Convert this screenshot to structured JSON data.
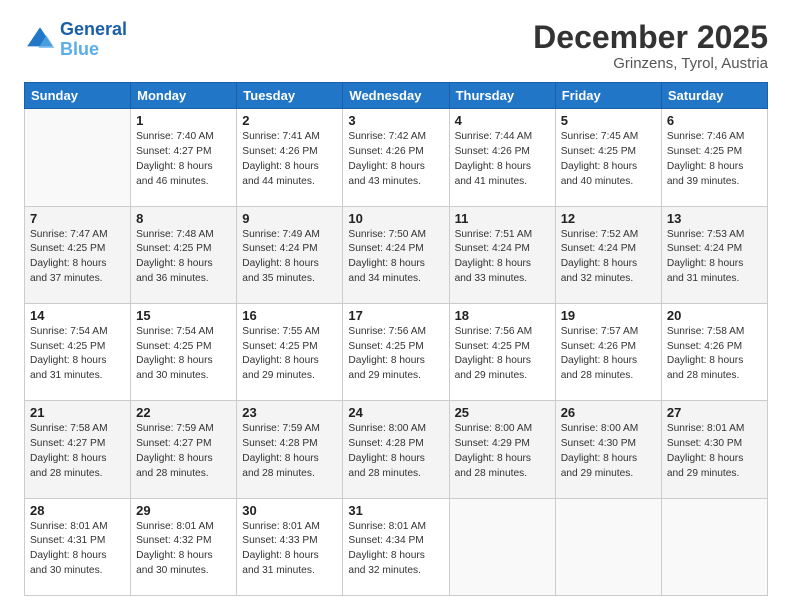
{
  "header": {
    "logo_line1": "General",
    "logo_line2": "Blue",
    "month": "December 2025",
    "location": "Grinzens, Tyrol, Austria"
  },
  "weekdays": [
    "Sunday",
    "Monday",
    "Tuesday",
    "Wednesday",
    "Thursday",
    "Friday",
    "Saturday"
  ],
  "weeks": [
    [
      {
        "day": "",
        "info": ""
      },
      {
        "day": "1",
        "info": "Sunrise: 7:40 AM\nSunset: 4:27 PM\nDaylight: 8 hours\nand 46 minutes."
      },
      {
        "day": "2",
        "info": "Sunrise: 7:41 AM\nSunset: 4:26 PM\nDaylight: 8 hours\nand 44 minutes."
      },
      {
        "day": "3",
        "info": "Sunrise: 7:42 AM\nSunset: 4:26 PM\nDaylight: 8 hours\nand 43 minutes."
      },
      {
        "day": "4",
        "info": "Sunrise: 7:44 AM\nSunset: 4:26 PM\nDaylight: 8 hours\nand 41 minutes."
      },
      {
        "day": "5",
        "info": "Sunrise: 7:45 AM\nSunset: 4:25 PM\nDaylight: 8 hours\nand 40 minutes."
      },
      {
        "day": "6",
        "info": "Sunrise: 7:46 AM\nSunset: 4:25 PM\nDaylight: 8 hours\nand 39 minutes."
      }
    ],
    [
      {
        "day": "7",
        "info": "Sunrise: 7:47 AM\nSunset: 4:25 PM\nDaylight: 8 hours\nand 37 minutes."
      },
      {
        "day": "8",
        "info": "Sunrise: 7:48 AM\nSunset: 4:25 PM\nDaylight: 8 hours\nand 36 minutes."
      },
      {
        "day": "9",
        "info": "Sunrise: 7:49 AM\nSunset: 4:24 PM\nDaylight: 8 hours\nand 35 minutes."
      },
      {
        "day": "10",
        "info": "Sunrise: 7:50 AM\nSunset: 4:24 PM\nDaylight: 8 hours\nand 34 minutes."
      },
      {
        "day": "11",
        "info": "Sunrise: 7:51 AM\nSunset: 4:24 PM\nDaylight: 8 hours\nand 33 minutes."
      },
      {
        "day": "12",
        "info": "Sunrise: 7:52 AM\nSunset: 4:24 PM\nDaylight: 8 hours\nand 32 minutes."
      },
      {
        "day": "13",
        "info": "Sunrise: 7:53 AM\nSunset: 4:24 PM\nDaylight: 8 hours\nand 31 minutes."
      }
    ],
    [
      {
        "day": "14",
        "info": "Sunrise: 7:54 AM\nSunset: 4:25 PM\nDaylight: 8 hours\nand 31 minutes."
      },
      {
        "day": "15",
        "info": "Sunrise: 7:54 AM\nSunset: 4:25 PM\nDaylight: 8 hours\nand 30 minutes."
      },
      {
        "day": "16",
        "info": "Sunrise: 7:55 AM\nSunset: 4:25 PM\nDaylight: 8 hours\nand 29 minutes."
      },
      {
        "day": "17",
        "info": "Sunrise: 7:56 AM\nSunset: 4:25 PM\nDaylight: 8 hours\nand 29 minutes."
      },
      {
        "day": "18",
        "info": "Sunrise: 7:56 AM\nSunset: 4:25 PM\nDaylight: 8 hours\nand 29 minutes."
      },
      {
        "day": "19",
        "info": "Sunrise: 7:57 AM\nSunset: 4:26 PM\nDaylight: 8 hours\nand 28 minutes."
      },
      {
        "day": "20",
        "info": "Sunrise: 7:58 AM\nSunset: 4:26 PM\nDaylight: 8 hours\nand 28 minutes."
      }
    ],
    [
      {
        "day": "21",
        "info": "Sunrise: 7:58 AM\nSunset: 4:27 PM\nDaylight: 8 hours\nand 28 minutes."
      },
      {
        "day": "22",
        "info": "Sunrise: 7:59 AM\nSunset: 4:27 PM\nDaylight: 8 hours\nand 28 minutes."
      },
      {
        "day": "23",
        "info": "Sunrise: 7:59 AM\nSunset: 4:28 PM\nDaylight: 8 hours\nand 28 minutes."
      },
      {
        "day": "24",
        "info": "Sunrise: 8:00 AM\nSunset: 4:28 PM\nDaylight: 8 hours\nand 28 minutes."
      },
      {
        "day": "25",
        "info": "Sunrise: 8:00 AM\nSunset: 4:29 PM\nDaylight: 8 hours\nand 28 minutes."
      },
      {
        "day": "26",
        "info": "Sunrise: 8:00 AM\nSunset: 4:30 PM\nDaylight: 8 hours\nand 29 minutes."
      },
      {
        "day": "27",
        "info": "Sunrise: 8:01 AM\nSunset: 4:30 PM\nDaylight: 8 hours\nand 29 minutes."
      }
    ],
    [
      {
        "day": "28",
        "info": "Sunrise: 8:01 AM\nSunset: 4:31 PM\nDaylight: 8 hours\nand 30 minutes."
      },
      {
        "day": "29",
        "info": "Sunrise: 8:01 AM\nSunset: 4:32 PM\nDaylight: 8 hours\nand 30 minutes."
      },
      {
        "day": "30",
        "info": "Sunrise: 8:01 AM\nSunset: 4:33 PM\nDaylight: 8 hours\nand 31 minutes."
      },
      {
        "day": "31",
        "info": "Sunrise: 8:01 AM\nSunset: 4:34 PM\nDaylight: 8 hours\nand 32 minutes."
      },
      {
        "day": "",
        "info": ""
      },
      {
        "day": "",
        "info": ""
      },
      {
        "day": "",
        "info": ""
      }
    ]
  ]
}
